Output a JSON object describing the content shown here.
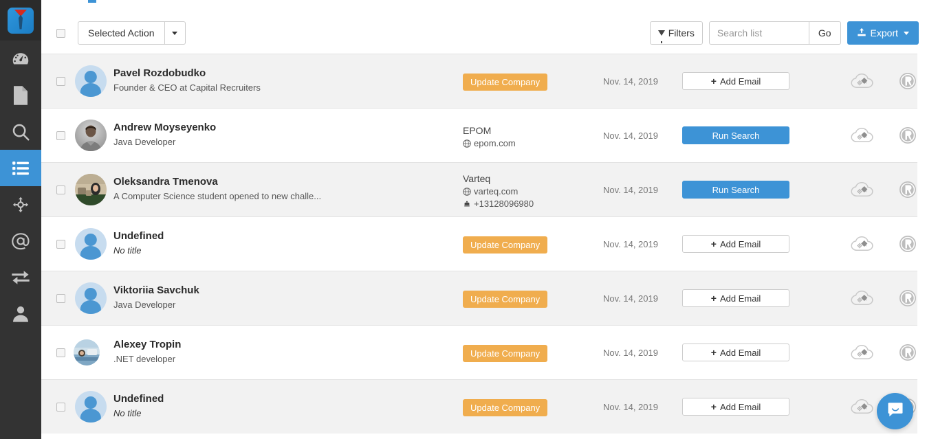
{
  "sidebar": {
    "logo_name": "app-logo",
    "items": [
      {
        "icon": "dashboard-icon",
        "label": "Dashboard",
        "active": false
      },
      {
        "icon": "file-icon",
        "label": "Documents",
        "active": false
      },
      {
        "icon": "search-icon",
        "label": "Search",
        "active": false
      },
      {
        "icon": "list-icon",
        "label": "Lists",
        "active": true
      },
      {
        "icon": "move-icon",
        "label": "Integrations",
        "active": false
      },
      {
        "icon": "at-icon",
        "label": "Email",
        "active": false
      },
      {
        "icon": "exchange-icon",
        "label": "Transfers",
        "active": false
      },
      {
        "icon": "user-icon",
        "label": "Account",
        "active": false
      }
    ]
  },
  "toolbar": {
    "selected_action_label": "Selected Action",
    "filters_label": "Filters",
    "search_placeholder": "Search list",
    "search_value": "",
    "go_label": "Go",
    "export_label": "Export"
  },
  "colors": {
    "accent_blue": "#3d93d6",
    "badge_orange": "#f0ad4e",
    "sidebar_dark": "#333333",
    "row_alt": "#f2f2f2"
  },
  "row_icons": {
    "cloud_upload": "cloud-upload-icon",
    "recruiter": "recruiter-r-icon",
    "remove": "remove-icon"
  },
  "rows": [
    {
      "name": "Pavel Rozdobudko",
      "title": "Founder & CEO at Capital Recruiters",
      "title_italic": false,
      "avatar": "default",
      "company_badge": "Update Company",
      "company_name": "",
      "company_site": "",
      "company_phone": "",
      "date": "Nov. 14, 2019",
      "action": "Add Email",
      "action_type": "add-email"
    },
    {
      "name": "Andrew Moyseyenko",
      "title": "Java Developer",
      "title_italic": false,
      "avatar": "photo-andrew",
      "company_badge": "",
      "company_name": "EPOM",
      "company_site": "epom.com",
      "company_phone": "",
      "date": "Nov. 14, 2019",
      "action": "Run Search",
      "action_type": "run-search"
    },
    {
      "name": "Oleksandra Tmenova",
      "title": "A Computer Science student opened to new challe...",
      "title_italic": false,
      "avatar": "photo-oleksandra",
      "company_badge": "",
      "company_name": "Varteq",
      "company_site": "varteq.com",
      "company_phone": "+13128096980",
      "date": "Nov. 14, 2019",
      "action": "Run Search",
      "action_type": "run-search"
    },
    {
      "name": "Undefined",
      "title": "No title",
      "title_italic": true,
      "avatar": "default",
      "company_badge": "Update Company",
      "company_name": "",
      "company_site": "",
      "company_phone": "",
      "date": "Nov. 14, 2019",
      "action": "Add Email",
      "action_type": "add-email"
    },
    {
      "name": "Viktoriia Savchuk",
      "title": "Java Developer",
      "title_italic": false,
      "avatar": "default",
      "company_badge": "Update Company",
      "company_name": "",
      "company_site": "",
      "company_phone": "",
      "date": "Nov. 14, 2019",
      "action": "Add Email",
      "action_type": "add-email"
    },
    {
      "name": "Alexey Tropin",
      "title": ".NET developer",
      "title_italic": false,
      "avatar": "photo-alexey",
      "company_badge": "Update Company",
      "company_name": "",
      "company_site": "",
      "company_phone": "",
      "date": "Nov. 14, 2019",
      "action": "Add Email",
      "action_type": "add-email"
    },
    {
      "name": "Undefined",
      "title": "No title",
      "title_italic": true,
      "avatar": "default",
      "company_badge": "Update Company",
      "company_name": "",
      "company_site": "",
      "company_phone": "",
      "date": "Nov. 14, 2019",
      "action": "Add Email",
      "action_type": "add-email"
    }
  ],
  "intercom": {
    "icon": "chat-bubble-icon",
    "label": "Open chat"
  }
}
